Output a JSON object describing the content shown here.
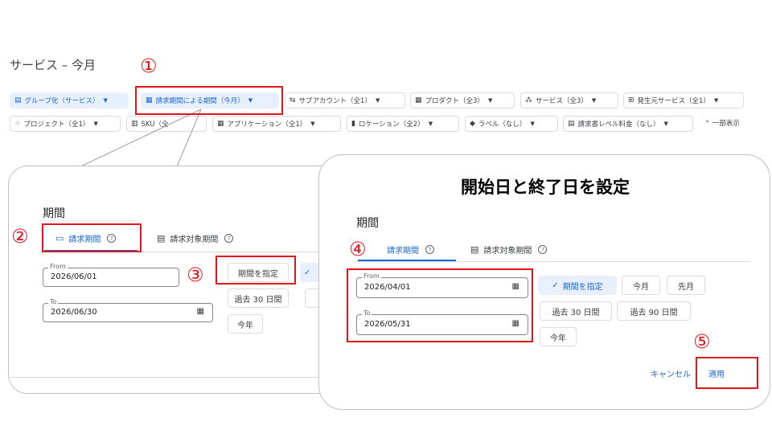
{
  "page_title": "サービス – 今月",
  "filter_chips": [
    {
      "label": "グループ化（サービス）",
      "icon": "▤",
      "icon_name": "group-icon"
    },
    {
      "label": "請求期間による期間（今月）",
      "icon": "▦",
      "icon_name": "calendar-icon"
    },
    {
      "label": "サブアカウント（全1）",
      "icon": "⇆",
      "icon_name": "subaccount-icon"
    },
    {
      "label": "プロダクト（全3）",
      "icon": "▦",
      "icon_name": "product-icon"
    },
    {
      "label": "サービス（全3）",
      "icon": "⁂",
      "icon_name": "service-icon"
    },
    {
      "label": "発生元サービス（全1）",
      "icon": "⊞",
      "icon_name": "origin-service-icon"
    },
    {
      "label": "プロジェクト（全1）",
      "icon": "⁘",
      "icon_name": "project-icon"
    },
    {
      "label": "SKU（全",
      "icon": "▥",
      "icon_name": "sku-icon"
    },
    {
      "label": "アプリケーション（全1）",
      "icon": "▦",
      "icon_name": "application-icon"
    },
    {
      "label": "ロケーション（全2）",
      "icon": "▮",
      "icon_name": "location-icon"
    },
    {
      "label": "ラベル（なし）",
      "icon": "◆",
      "icon_name": "label-icon"
    },
    {
      "label": "請求書レベル料金（なし）",
      "icon": "▤",
      "icon_name": "invoice-icon"
    }
  ],
  "show_less": "一部表示",
  "panel1": {
    "title": "期間",
    "tab_billing": "請求期間",
    "tab_usage": "請求対象期間",
    "from_label": "From",
    "from_value": "2026/06/01",
    "to_label": "To",
    "to_value": "2026/06/30",
    "btn_custom": "期間を指定",
    "btn_30days": "過去 30 日間",
    "btn_this_year": "今年"
  },
  "panel2": {
    "heading": "開始日と終了日を設定",
    "title": "期間",
    "tab_billing": "請求期間",
    "tab_usage": "請求対象期間",
    "from_label": "From",
    "from_value": "2026/04/01",
    "to_label": "To",
    "to_value": "2026/05/31",
    "btn_custom": "期間を指定",
    "btn_this_month": "今月",
    "btn_last_month": "先月",
    "btn_30days": "過去 30 日間",
    "btn_90days": "過去 90 日間",
    "btn_this_year": "今年",
    "cancel": "キャンセル",
    "apply": "適用"
  },
  "step_numbers": [
    "①",
    "②",
    "③",
    "④",
    "⑤"
  ],
  "colors": {
    "accent": "#1967d2",
    "highlight": "#e0161b",
    "selected_bg": "#e8f0fe"
  }
}
